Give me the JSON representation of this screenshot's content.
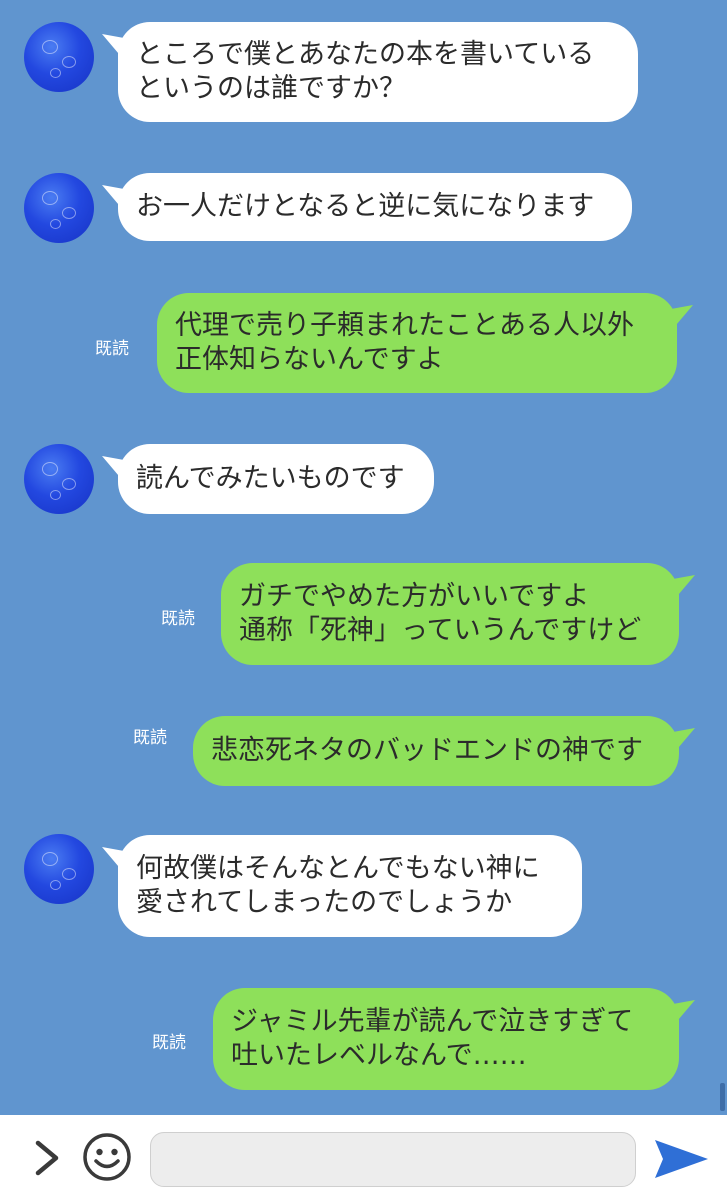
{
  "messages": [
    {
      "side": "in",
      "text": "ところで僕とあなたの本を書いている\nというのは誰ですか？"
    },
    {
      "side": "in",
      "text": "お一人だけとなると逆に気になります"
    },
    {
      "side": "out",
      "read": "既読",
      "text": "代理で売り子頼まれたことある人以外\n正体知らないんですよ"
    },
    {
      "side": "in",
      "text": "読んでみたいものです"
    },
    {
      "side": "out",
      "read": "既読",
      "text": "ガチでやめた方がいいですよ\n通称「死神」っていうんですけど"
    },
    {
      "side": "out",
      "read": "既読",
      "text": "悲恋死ネタのバッドエンドの神です"
    },
    {
      "side": "in",
      "text": "何故僕はそんなとんでもない神に\n愛されてしまったのでしょうか"
    },
    {
      "side": "out",
      "read": "既読",
      "text": "ジャミル先輩が読んで泣きすぎて\n吐いたレベルなんで……"
    }
  ],
  "input": {
    "value": "",
    "placeholder": ""
  },
  "icons": {
    "expand": "chevron-right-icon",
    "emoji": "smiley-icon",
    "send": "send-arrow-icon"
  },
  "colors": {
    "background": "#6095cf",
    "incoming_bubble": "#ffffff",
    "outgoing_bubble": "#8ee05a",
    "send_icon": "#2f6fd6"
  }
}
